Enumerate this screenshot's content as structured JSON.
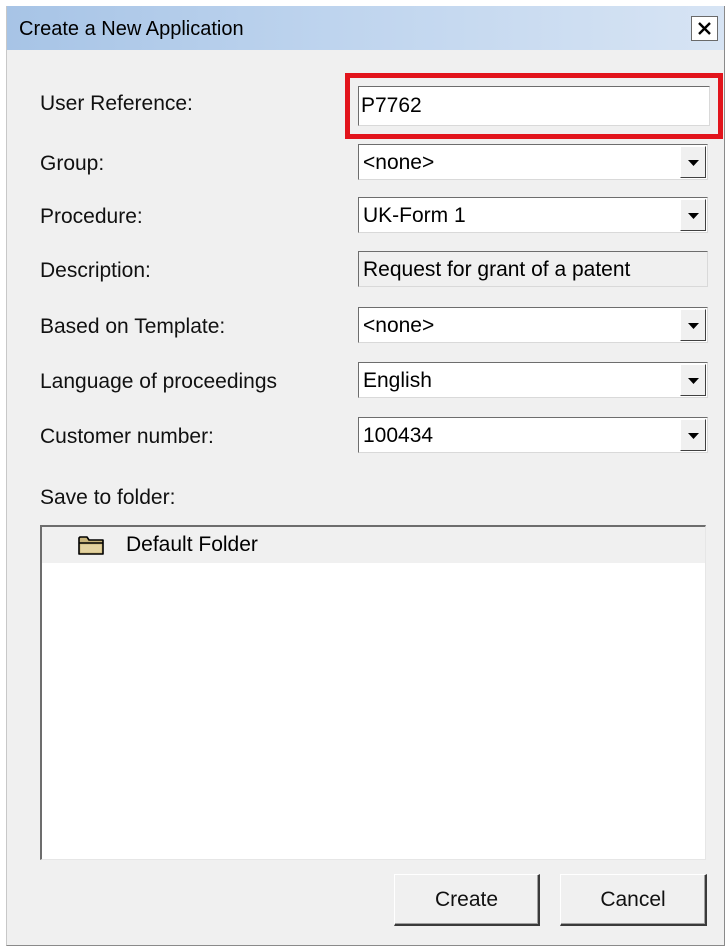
{
  "window": {
    "title": "Create a New Application",
    "close_label": "×"
  },
  "form": {
    "user_reference": {
      "label": "User Reference:",
      "value": "P7762"
    },
    "group": {
      "label": "Group:",
      "value": "<none>"
    },
    "procedure": {
      "label": "Procedure:",
      "value": "UK-Form 1"
    },
    "description": {
      "label": "Description:",
      "value": "Request for grant of a patent"
    },
    "template": {
      "label": "Based on Template:",
      "value": "<none>"
    },
    "language": {
      "label": "Language of proceedings",
      "value": "English"
    },
    "customer_number": {
      "label": "Customer number:",
      "value": "100434"
    }
  },
  "folders": {
    "label": "Save to folder:",
    "items": [
      {
        "name": "Default Folder",
        "icon": "folder-icon"
      }
    ]
  },
  "buttons": {
    "create": "Create",
    "cancel": "Cancel"
  },
  "colors": {
    "highlight": "#e2141c",
    "titlebar": "#bed4ee",
    "dialog_bg": "#f0f0f0"
  }
}
